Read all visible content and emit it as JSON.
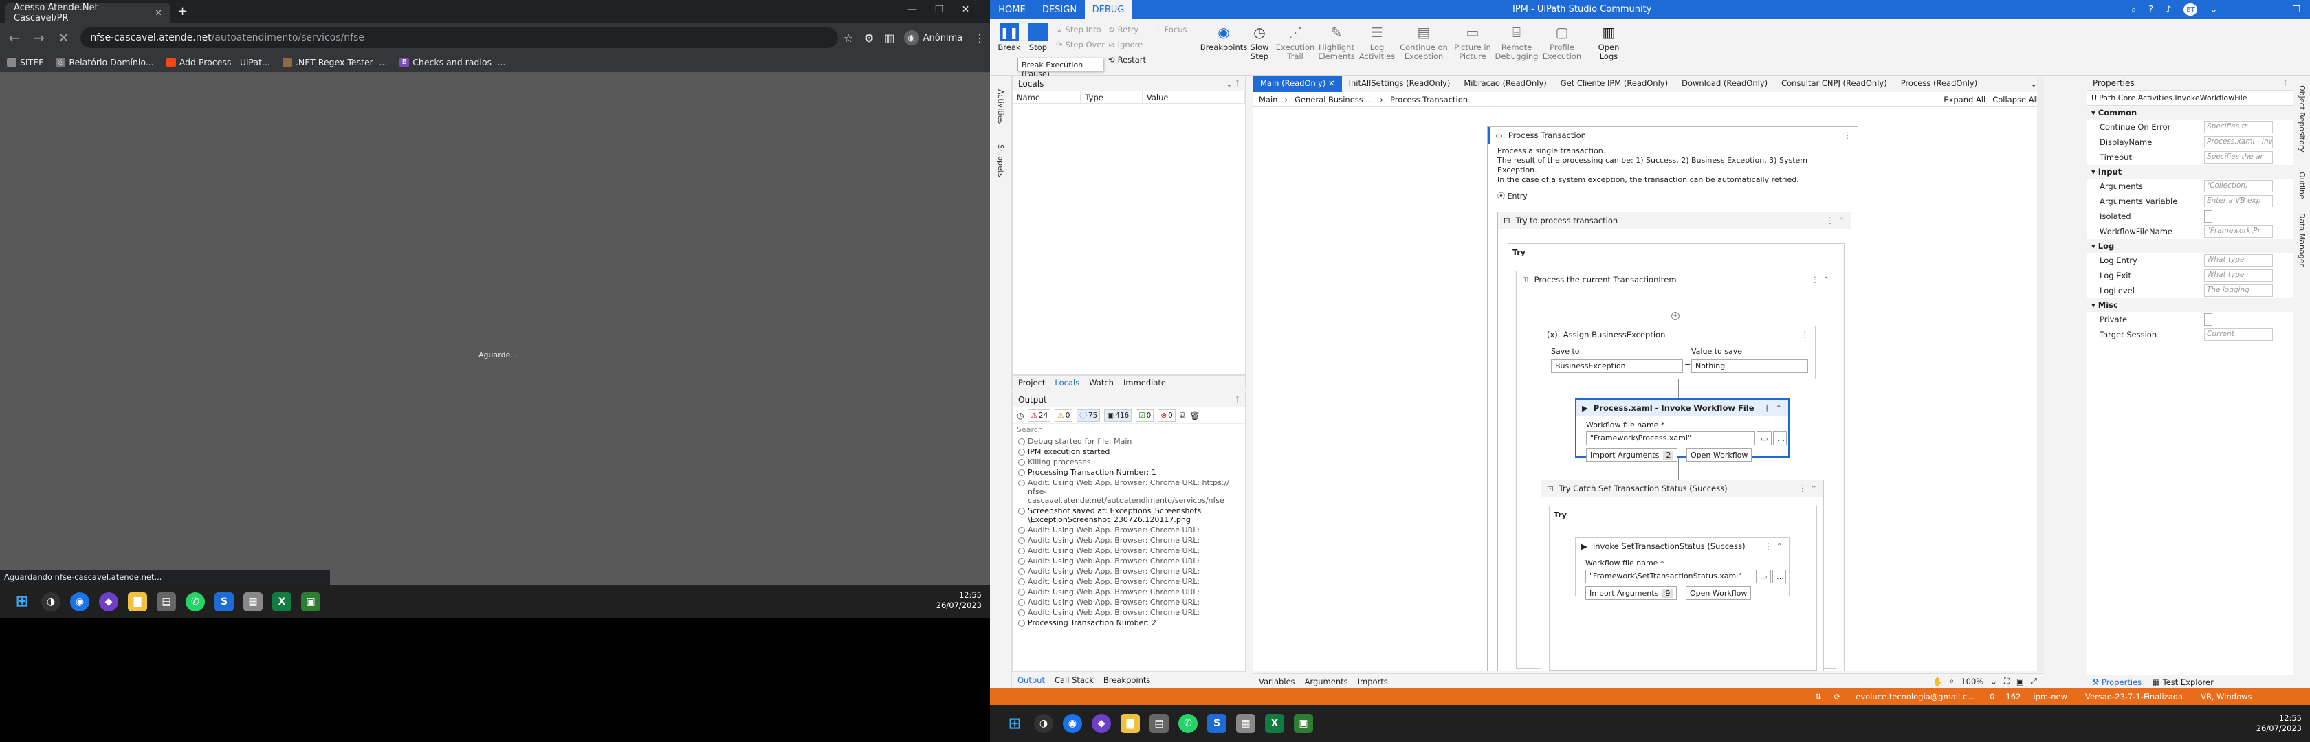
{
  "chrome": {
    "tab_title": "Acesso Atende.Net - Cascavel/PR",
    "url_host": "nfse-cascavel.atende.net",
    "url_path": "/autoatendimento/servicos/nfse",
    "profile": "Anônima",
    "bookmarks": [
      "SITEF",
      "Relatório Domínio...",
      "Add Process - UiPat...",
      ".NET Regex Tester -...",
      "Checks and radios -..."
    ],
    "page_text": "Aguarde...",
    "status_text": "Aguardando nfse-cascavel.atende.net..."
  },
  "taskbar_left": {
    "time": "12:55",
    "date": "26/07/2023"
  },
  "studio": {
    "tabs": [
      "HOME",
      "DESIGN",
      "DEBUG"
    ],
    "title": "IPM - UiPath Studio Community",
    "user_initials": "ET",
    "ribbon": {
      "break": "Break",
      "stop": "Stop",
      "step_into": "Step Into",
      "step_over": "Step Over",
      "retry": "Retry",
      "ignore": "Ignore",
      "focus": "Focus",
      "restart": "Restart",
      "breakpoints": "Breakpoints",
      "slow_step": "Slow Step",
      "execution_trail": "Execution Trail",
      "highlight_elements": "Highlight Elements",
      "log_activities": "Log Activities",
      "continue_on_exception": "Continue on Exception",
      "picture_in_picture": "Picture in Picture",
      "remote_debugging": "Remote Debugging",
      "profile_execution": "Profile Execution",
      "open_logs": "Open Logs"
    },
    "tooltip": "Break Execution (Pause)",
    "side_left": [
      "Activities",
      "Snippets"
    ],
    "locals": {
      "title": "Locals",
      "cols": [
        "Name",
        "Type",
        "Value"
      ]
    },
    "panel_tabs": [
      "Project",
      "Locals",
      "Watch",
      "Immediate"
    ],
    "output": {
      "title": "Output",
      "counts": {
        "err": "24",
        "warn": "0",
        "info": "75",
        "trace": "416",
        "ok": "0",
        "fatal": "0"
      },
      "search": "Search",
      "lines": [
        "Debug started for file: Main",
        "IPM execution started",
        "Killing processes...",
        "Processing Transaction Number: 1",
        "Audit: Using Web App. Browser: Chrome URL: https:// nfse-cascavel.atende.net/autoatendimento/servicos/nfse",
        "Screenshot saved at: Exceptions_Screenshots \\ExceptionScreenshot_230726.120117.png",
        "Audit: Using Web App. Browser: Chrome URL:",
        "Audit: Using Web App. Browser: Chrome URL:",
        "Audit: Using Web App. Browser: Chrome URL:",
        "Audit: Using Web App. Browser: Chrome URL:",
        "Audit: Using Web App. Browser: Chrome URL:",
        "Audit: Using Web App. Browser: Chrome URL:",
        "Audit: Using Web App. Browser: Chrome URL:",
        "Audit: Using Web App. Browser: Chrome URL:",
        "Audit: Using Web App. Browser: Chrome URL:",
        "Processing Transaction Number: 2"
      ],
      "bottom_tabs": [
        "Output",
        "Call Stack",
        "Breakpoints"
      ]
    },
    "doc_tabs": [
      "Main (ReadOnly)",
      "InitAllSettings (ReadOnly)",
      "Mibracao (ReadOnly)",
      "Get Cliente IPM (ReadOnly)",
      "Download (ReadOnly)",
      "Consultar CNPJ (ReadOnly)",
      "Process (ReadOnly)"
    ],
    "breadcrumb": [
      "Main",
      "General Business ...",
      "Process Transaction"
    ],
    "expand_all": "Expand All",
    "collapse_all": "Collapse All",
    "canvas": {
      "process_transaction": "Process Transaction",
      "description": [
        "Process a single transaction.",
        "The result of the processing can be: 1) Success, 2) Business Exception, 3) System Exception.",
        "In the case of a system exception, the transaction can be automatically retried."
      ],
      "entry": "Entry",
      "try_process": "Try to process transaction",
      "try": "Try",
      "process_current": "Process the current TransactionItem",
      "assign": "Assign BusinessException",
      "save_to": "Save to",
      "value_to_save": "Value to save",
      "save_to_value": "BusinessException",
      "value_value": "Nothing",
      "invoke": "Process.xaml - Invoke Workflow File",
      "wf_label": "Workflow file name *",
      "wf_value": "\"Framework\\Process.xaml\"",
      "import_args": "Import Arguments",
      "args_count": "2",
      "open_workflow": "Open Workflow",
      "try_catch": "Try Catch Set Transaction Status (Success)",
      "try2": "Try",
      "invoke2": "Invoke SetTransactionStatus (Success)",
      "wf_label2": "Workflow file name *",
      "wf_value2": "\"Framework\\SetTransactionStatus.xaml\"",
      "import_args2": "Import Arguments",
      "args_count2": "9",
      "open_workflow2": "Open Workflow"
    },
    "designer_bottom": [
      "Variables",
      "Arguments",
      "Imports"
    ],
    "zoom": "100%",
    "properties": {
      "title": "Properties",
      "type": "UiPath.Core.Activities.InvokeWorkflowFile",
      "cat_common": "Common",
      "common": [
        [
          "Continue On Error",
          "Specifies tr"
        ],
        [
          "DisplayName",
          "Process.xaml - Invok"
        ],
        [
          "Timeout",
          "Specifies the ar"
        ]
      ],
      "cat_input": "Input",
      "input": [
        [
          "Arguments",
          "(Collection)"
        ],
        [
          "Arguments Variable",
          "Enter a VB exp"
        ],
        [
          "Isolated",
          ""
        ],
        [
          "WorkflowFileName",
          "\"Framework\\Pr"
        ]
      ],
      "cat_log": "Log",
      "log": [
        [
          "Log Entry",
          "What type"
        ],
        [
          "Log Exit",
          "What type"
        ],
        [
          "LogLevel",
          "The logging"
        ]
      ],
      "cat_misc": "Misc",
      "misc": [
        [
          "Private",
          ""
        ],
        [
          "Target Session",
          "Current"
        ]
      ],
      "bottom": [
        "Properties",
        "Test Explorer"
      ]
    },
    "side_right": [
      "Object Repository",
      "Outline",
      "Data Manager"
    ],
    "status": {
      "account": "evoluce.tecnologia@gmail.c...",
      "a": "0",
      "b": "162",
      "branch": "ipm-new",
      "version": "Versao-23-7-1-Finalizada",
      "vb": "VB, Windows"
    }
  },
  "taskbar_right": {
    "time": "12:55",
    "date": "26/07/2023"
  }
}
